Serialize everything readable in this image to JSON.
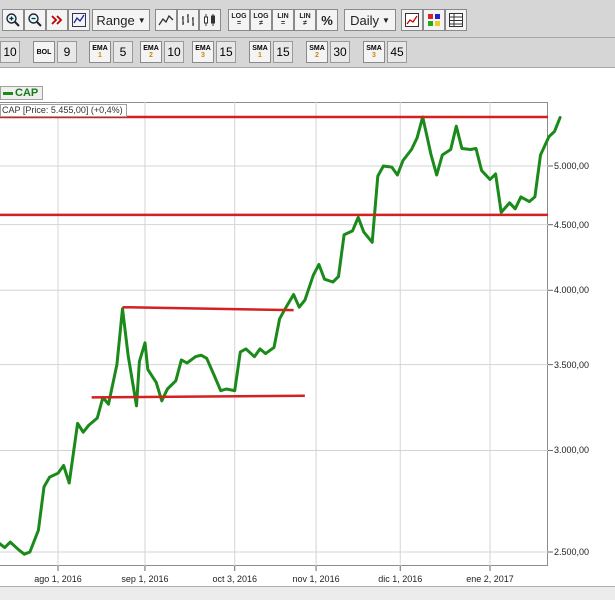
{
  "toolbar": {
    "range_label": "Range",
    "interval_label": "Daily",
    "log1_top": "LOG",
    "log1_bottom": "=",
    "log2_top": "LOG",
    "log2_bottom": "≠",
    "lin1_top": "LIN",
    "lin1_bottom": "=",
    "lin2_top": "LIN",
    "lin2_bottom": "≠",
    "pct_label": "%"
  },
  "params": {
    "first_value": "10",
    "bol_label": "BOL",
    "bol_value": "9",
    "ema1_label": "EMA",
    "ema1_idx": "1",
    "ema1_value": "5",
    "ema2_label": "EMA",
    "ema2_idx": "2",
    "ema2_value": "10",
    "ema3_label": "EMA",
    "ema3_idx": "3",
    "ema3_value": "15",
    "sma1_label": "SMA",
    "sma1_idx": "1",
    "sma1_value": "15",
    "sma2_label": "SMA",
    "sma2_idx": "2",
    "sma2_value": "30",
    "sma3_label": "SMA",
    "sma3_idx": "3",
    "sma3_value": "45"
  },
  "legend": {
    "symbol": "CAP",
    "price_text": "CAP [Price: 5.455,00] (+0,4%)"
  },
  "colors": {
    "series": "#1a8a1a",
    "trendlines": "#d42020"
  },
  "chart_data": {
    "type": "line",
    "title": "",
    "ylabel": "",
    "xlabel": "",
    "yscale": "log",
    "ylim": [
      2450,
      5500
    ],
    "yticks": [
      2500,
      3000,
      3500,
      4000,
      4500,
      5000
    ],
    "yticklabels": [
      "2.500,00",
      "3.000,00",
      "3.500,00",
      "4.000,00",
      "4.500,00",
      "5.000,00"
    ],
    "xticks": [
      "2016-08-01",
      "2016-09-01",
      "2016-10-03",
      "2016-11-01",
      "2016-12-01",
      "2017-01-02"
    ],
    "xticklabels": [
      "ago 1, 2016",
      "sep 1, 2016",
      "oct 3, 2016",
      "nov 1, 2016",
      "dic 1, 2016",
      "ene 2, 2017"
    ],
    "grid": true,
    "series": [
      {
        "name": "CAP",
        "points": [
          [
            "2016-07-11",
            2540
          ],
          [
            "2016-07-13",
            2520
          ],
          [
            "2016-07-15",
            2545
          ],
          [
            "2016-07-18",
            2510
          ],
          [
            "2016-07-20",
            2490
          ],
          [
            "2016-07-22",
            2500
          ],
          [
            "2016-07-25",
            2600
          ],
          [
            "2016-07-27",
            2810
          ],
          [
            "2016-07-29",
            2860
          ],
          [
            "2016-08-01",
            2880
          ],
          [
            "2016-08-03",
            2920
          ],
          [
            "2016-08-05",
            2830
          ],
          [
            "2016-08-08",
            3150
          ],
          [
            "2016-08-10",
            3100
          ],
          [
            "2016-08-12",
            3140
          ],
          [
            "2016-08-15",
            3180
          ],
          [
            "2016-08-17",
            3300
          ],
          [
            "2016-08-19",
            3260
          ],
          [
            "2016-08-22",
            3500
          ],
          [
            "2016-08-24",
            3870
          ],
          [
            "2016-08-26",
            3560
          ],
          [
            "2016-08-29",
            3250
          ],
          [
            "2016-08-30",
            3520
          ],
          [
            "2016-09-01",
            3640
          ],
          [
            "2016-09-02",
            3470
          ],
          [
            "2016-09-05",
            3390
          ],
          [
            "2016-09-07",
            3280
          ],
          [
            "2016-09-09",
            3350
          ],
          [
            "2016-09-12",
            3400
          ],
          [
            "2016-09-14",
            3530
          ],
          [
            "2016-09-16",
            3510
          ],
          [
            "2016-09-19",
            3550
          ],
          [
            "2016-09-21",
            3560
          ],
          [
            "2016-09-23",
            3540
          ],
          [
            "2016-09-26",
            3420
          ],
          [
            "2016-09-28",
            3340
          ],
          [
            "2016-09-30",
            3350
          ],
          [
            "2016-10-03",
            3340
          ],
          [
            "2016-10-05",
            3580
          ],
          [
            "2016-10-07",
            3600
          ],
          [
            "2016-10-10",
            3550
          ],
          [
            "2016-10-12",
            3600
          ],
          [
            "2016-10-14",
            3570
          ],
          [
            "2016-10-17",
            3610
          ],
          [
            "2016-10-19",
            3800
          ],
          [
            "2016-10-21",
            3870
          ],
          [
            "2016-10-24",
            3970
          ],
          [
            "2016-10-26",
            3880
          ],
          [
            "2016-10-28",
            3930
          ],
          [
            "2016-10-31",
            4110
          ],
          [
            "2016-11-02",
            4190
          ],
          [
            "2016-11-04",
            4080
          ],
          [
            "2016-11-07",
            4060
          ],
          [
            "2016-11-09",
            4100
          ],
          [
            "2016-11-11",
            4420
          ],
          [
            "2016-11-14",
            4450
          ],
          [
            "2016-11-16",
            4560
          ],
          [
            "2016-11-18",
            4440
          ],
          [
            "2016-11-21",
            4360
          ],
          [
            "2016-11-23",
            4910
          ],
          [
            "2016-11-25",
            5000
          ],
          [
            "2016-11-28",
            4990
          ],
          [
            "2016-11-30",
            4920
          ],
          [
            "2016-12-02",
            5050
          ],
          [
            "2016-12-05",
            5150
          ],
          [
            "2016-12-07",
            5260
          ],
          [
            "2016-12-09",
            5460
          ],
          [
            "2016-12-12",
            5100
          ],
          [
            "2016-12-14",
            4920
          ],
          [
            "2016-12-16",
            5100
          ],
          [
            "2016-12-19",
            5150
          ],
          [
            "2016-12-21",
            5370
          ],
          [
            "2016-12-23",
            5160
          ],
          [
            "2016-12-26",
            5150
          ],
          [
            "2016-12-28",
            5160
          ],
          [
            "2016-12-30",
            4960
          ],
          [
            "2017-01-02",
            4880
          ],
          [
            "2017-01-04",
            4930
          ],
          [
            "2017-01-06",
            4600
          ],
          [
            "2017-01-09",
            4680
          ],
          [
            "2017-01-11",
            4630
          ],
          [
            "2017-01-13",
            4730
          ],
          [
            "2017-01-16",
            4690
          ],
          [
            "2017-01-18",
            4730
          ],
          [
            "2017-01-20",
            5100
          ],
          [
            "2017-01-23",
            5270
          ],
          [
            "2017-01-25",
            5320
          ],
          [
            "2017-01-27",
            5455
          ]
        ]
      }
    ],
    "trendlines": [
      {
        "from": [
          "2016-07-01",
          5460
        ],
        "to": [
          "2017-02-05",
          5460
        ]
      },
      {
        "from": [
          "2016-07-01",
          4580
        ],
        "to": [
          "2017-02-05",
          4580
        ]
      },
      {
        "from": [
          "2016-08-24",
          3880
        ],
        "to": [
          "2016-10-24",
          3860
        ]
      },
      {
        "from": [
          "2016-08-13",
          3300
        ],
        "to": [
          "2016-10-28",
          3310
        ]
      }
    ]
  }
}
